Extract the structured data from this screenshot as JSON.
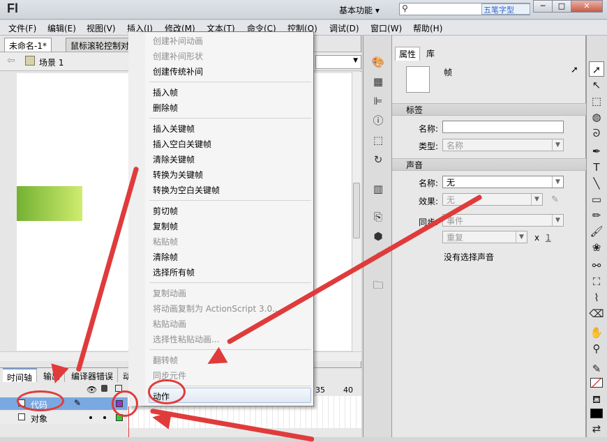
{
  "app": {
    "logo": "Fl",
    "workspace": "基本功能",
    "workspace_caret": "▾",
    "ime_label": "五笔字型",
    "search_placeholder": ""
  },
  "window_buttons": [
    "─",
    "□",
    "✕"
  ],
  "menubar": [
    "文件(F)",
    "编辑(E)",
    "视图(V)",
    "插入(I)",
    "修改(M)",
    "文本(T)",
    "命令(C)",
    "控制(O)",
    "调试(D)",
    "窗口(W)",
    "帮助(H)"
  ],
  "doc_tabs": [
    "未命名-1*",
    "鼠标滚轮控制对"
  ],
  "scene": {
    "label": "场景 1",
    "back_arrow": "⇦"
  },
  "context_menu": {
    "items": [
      {
        "label": "创建补间动画",
        "enabled": false
      },
      {
        "label": "创建补间形状",
        "enabled": false
      },
      {
        "label": "创建传统补间",
        "enabled": true
      },
      {
        "label": "插入帧",
        "enabled": true
      },
      {
        "label": "删除帧",
        "enabled": true
      },
      {
        "label": "插入关键帧",
        "enabled": true
      },
      {
        "label": "插入空白关键帧",
        "enabled": true
      },
      {
        "label": "清除关键帧",
        "enabled": true
      },
      {
        "label": "转换为关键帧",
        "enabled": true
      },
      {
        "label": "转换为空白关键帧",
        "enabled": true
      },
      {
        "label": "剪切帧",
        "enabled": true
      },
      {
        "label": "复制帧",
        "enabled": true
      },
      {
        "label": "粘贴帧",
        "enabled": false
      },
      {
        "label": "清除帧",
        "enabled": true
      },
      {
        "label": "选择所有帧",
        "enabled": true
      },
      {
        "label": "复制动画",
        "enabled": false
      },
      {
        "label": "将动画复制为 ActionScript 3.0...",
        "enabled": false
      },
      {
        "label": "粘贴动画",
        "enabled": false
      },
      {
        "label": "选择性粘贴动画...",
        "enabled": false
      },
      {
        "label": "翻转帧",
        "enabled": false
      },
      {
        "label": "同步元件",
        "enabled": false
      },
      {
        "label": "动作",
        "enabled": true,
        "highlighted": true
      }
    ]
  },
  "timeline": {
    "tabs": [
      "时间轴",
      "输出",
      "编译器错误",
      "动"
    ],
    "frame_numbers": [
      "35",
      "40"
    ],
    "layers": [
      {
        "name": "代码",
        "selected": true,
        "color": "#9933cc"
      },
      {
        "name": "对象",
        "selected": false,
        "color": "#33cc33"
      }
    ],
    "header_icons": [
      "eye-icon",
      "lock-icon",
      "outline-icon"
    ]
  },
  "properties": {
    "tabs": [
      "属性",
      "库"
    ],
    "type_label": "帧",
    "label_section": "标签",
    "name_label": "名称:",
    "name_value": "",
    "type_field_label": "类型:",
    "type_value": "名称",
    "sound_section": "声音",
    "sound_name_label": "名称:",
    "sound_name_value": "无",
    "effect_label": "效果:",
    "effect_value": "无",
    "sync_label": "同步:",
    "sync_value": "事件",
    "repeat_value": "重复",
    "repeat_x": "x",
    "repeat_count": "1",
    "no_sound": "没有选择声音"
  },
  "colors": {
    "accent_red": "#e03b3b",
    "highlight_layer": "#7aa8e0"
  }
}
